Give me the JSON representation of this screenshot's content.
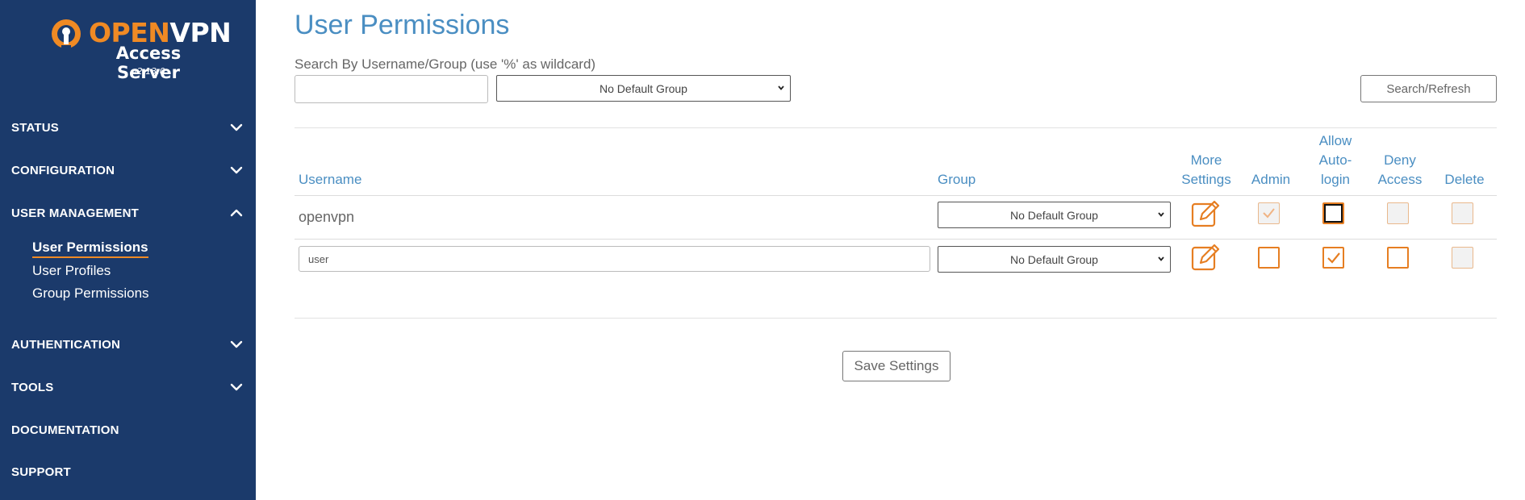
{
  "brand": {
    "name_part1": "OPEN",
    "name_part2": "VPN",
    "product": "Access Server",
    "version": "v2.13.0",
    "colors": {
      "orange": "#f08a24",
      "sidebar": "#1b3a6b",
      "accent_blue": "#4a8ec2"
    }
  },
  "sidebar": {
    "items": [
      {
        "label": "STATUS",
        "icon": "chevron-down-icon"
      },
      {
        "label": "CONFIGURATION",
        "icon": "chevron-down-icon"
      },
      {
        "label": "USER MANAGEMENT",
        "icon": "chevron-up-icon"
      },
      {
        "label": "AUTHENTICATION",
        "icon": "chevron-down-icon"
      },
      {
        "label": "TOOLS",
        "icon": "chevron-down-icon"
      },
      {
        "label": "DOCUMENTATION"
      },
      {
        "label": "SUPPORT"
      }
    ],
    "subitems": [
      {
        "label": "User Permissions",
        "active": true
      },
      {
        "label": "User Profiles",
        "active": false
      },
      {
        "label": "Group Permissions",
        "active": false
      }
    ]
  },
  "main": {
    "title": "User Permissions",
    "search": {
      "label": "Search By Username/Group (use '%' as wildcard)",
      "value": "",
      "group_select": "No Default Group",
      "button": "Search/Refresh"
    },
    "table": {
      "headers": {
        "username": "Username",
        "group": "Group",
        "more_settings": [
          "More",
          "Settings"
        ],
        "admin": "Admin",
        "allow_autologin": [
          "Allow",
          "Auto-",
          "login"
        ],
        "deny_access": [
          "Deny",
          "Access"
        ],
        "delete": "Delete"
      },
      "rows": [
        {
          "username": "openvpn",
          "group": "No Default Group",
          "admin": "checked-disabled",
          "allow_autologin": "unchecked-focused",
          "deny_access": "disabled",
          "delete": "disabled"
        },
        {
          "username": "user",
          "group": "No Default Group",
          "admin": "unchecked",
          "allow_autologin": "checked",
          "deny_access": "unchecked",
          "delete": "disabled"
        }
      ]
    },
    "save_button": "Save Settings"
  }
}
